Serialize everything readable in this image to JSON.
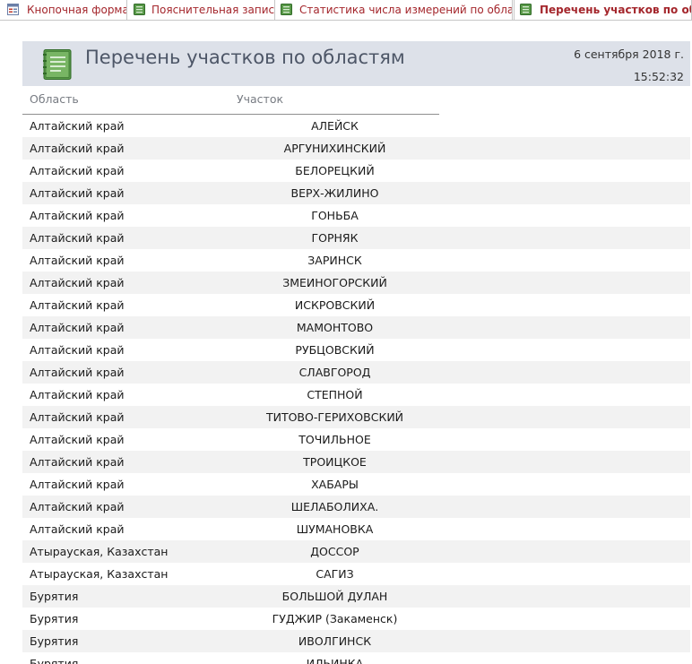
{
  "tabs": [
    {
      "label": "Кнопочная форма",
      "icon": "form-icon",
      "active": false
    },
    {
      "label": "Пояснительная записка",
      "icon": "report-icon",
      "active": false
    },
    {
      "label": "Статистика числа измерений по областям",
      "icon": "report-icon",
      "active": false
    },
    {
      "label": "Перечень участков по областям",
      "icon": "report-icon",
      "active": true
    }
  ],
  "report": {
    "title": "Перечень участков по областям",
    "date": "6 сентября 2018 г.",
    "time": "15:52:32",
    "col_oblast": "Область",
    "col_uchastok": "Участок"
  },
  "colors": {
    "tab_text": "#a4262c",
    "header_bg": "#dde1e9",
    "title_text": "#4d5667",
    "alt_row": "#f2f2f2",
    "icon_green": "#5a9a4a"
  },
  "rows": [
    {
      "oblast": "Алтайский край",
      "uchastok": "АЛЕЙСК"
    },
    {
      "oblast": "Алтайский край",
      "uchastok": "АРГУНИХИНСКИЙ"
    },
    {
      "oblast": "Алтайский край",
      "uchastok": "БЕЛОРЕЦКИЙ"
    },
    {
      "oblast": "Алтайский край",
      "uchastok": "ВЕРХ-ЖИЛИНО"
    },
    {
      "oblast": "Алтайский край",
      "uchastok": "ГОНЬБА"
    },
    {
      "oblast": "Алтайский край",
      "uchastok": "ГОРНЯК"
    },
    {
      "oblast": "Алтайский край",
      "uchastok": "ЗАРИНСК"
    },
    {
      "oblast": "Алтайский край",
      "uchastok": "ЗМЕИНОГОРСКИЙ"
    },
    {
      "oblast": "Алтайский край",
      "uchastok": "ИСКРОВСКИЙ"
    },
    {
      "oblast": "Алтайский край",
      "uchastok": "МАМОНТОВО"
    },
    {
      "oblast": "Алтайский край",
      "uchastok": "РУБЦОВСКИЙ"
    },
    {
      "oblast": "Алтайский край",
      "uchastok": "СЛАВГОРОД"
    },
    {
      "oblast": "Алтайский край",
      "uchastok": "СТЕПНОЙ"
    },
    {
      "oblast": "Алтайский край",
      "uchastok": "ТИТОВО-ГЕРИХОВСКИЙ"
    },
    {
      "oblast": "Алтайский край",
      "uchastok": "ТОЧИЛЬНОЕ"
    },
    {
      "oblast": "Алтайский край",
      "uchastok": "ТРОИЦКОЕ"
    },
    {
      "oblast": "Алтайский край",
      "uchastok": "ХАБАРЫ"
    },
    {
      "oblast": "Алтайский край",
      "uchastok": "ШЕЛАБОЛИХА."
    },
    {
      "oblast": "Алтайский край",
      "uchastok": "ШУМАНОВКА"
    },
    {
      "oblast": "Атырауская, Казахстан",
      "uchastok": "ДОССОР"
    },
    {
      "oblast": "Атырауская, Казахстан",
      "uchastok": "САГИЗ"
    },
    {
      "oblast": "Бурятия",
      "uchastok": "БОЛЬШОЙ ДУЛАН"
    },
    {
      "oblast": "Бурятия",
      "uchastok": "ГУДЖИР (Закаменск)"
    },
    {
      "oblast": "Бурятия",
      "uchastok": "ИВОЛГИНСК"
    },
    {
      "oblast": "Бурятия",
      "uchastok": "ИЛЬИНКА"
    }
  ]
}
